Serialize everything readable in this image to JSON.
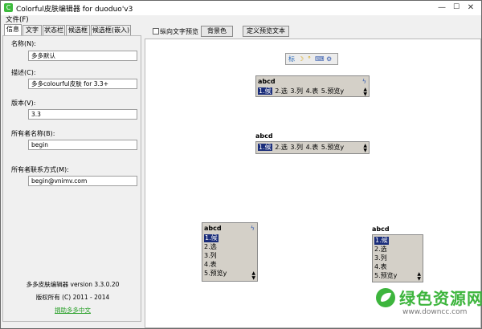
{
  "window": {
    "title": "Colorful皮肤编辑器 for duoduo'v3",
    "minimize_glyph": "—",
    "maximize_glyph": "☐",
    "close_glyph": "✕"
  },
  "menu": {
    "file": "文件(F)"
  },
  "tabs": [
    "信息",
    "文字",
    "状态栏",
    "候选框",
    "候选框(嵌入)"
  ],
  "info_panel": {
    "fields": [
      {
        "label": "名称(N):",
        "value": "多多默认"
      },
      {
        "label": "描述(C):",
        "value": "多多colourful皮肤 for 3.3+"
      },
      {
        "label": "版本(V):",
        "value": "3.3"
      },
      {
        "label": "所有者名称(B):",
        "value": "begin"
      },
      {
        "label": "所有者联系方式(M):",
        "value": "begin@vnimv.com"
      }
    ],
    "footer": {
      "version": "多多皮肤编辑器 version 3.3.0.20",
      "copyright": "版权所有 (C) 2011 - 2014",
      "donate": "捐助多多中文"
    }
  },
  "preview_toolbar": {
    "vertical_checkbox_label": "纵向文字预览",
    "vertical_checked": false,
    "background_button": "背景色",
    "custom_text_button": "定义预览文本"
  },
  "status_bar_icons": [
    "标",
    "☽",
    "°",
    "⌨",
    "⚙"
  ],
  "candidate_preview": {
    "code": "abcd",
    "candidates": [
      "1.候",
      "2.选",
      "3.列",
      "4.表",
      "5.预览y"
    ],
    "flag_icon": "ϟ",
    "arrow_up": "▲",
    "arrow_down": "▼"
  },
  "watermark": {
    "title": "绿色资源网",
    "url": "www.downcc.com"
  },
  "colors": {
    "highlight": "#1a2d7a",
    "watermark_green": "#3db53d"
  }
}
